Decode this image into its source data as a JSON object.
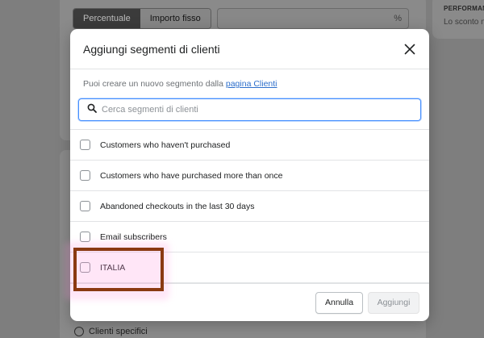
{
  "background": {
    "discount_type_options": [
      "Percentuale",
      "Importo fisso"
    ],
    "selected_discount_type": "Percentuale",
    "value_suffix": "%",
    "performance_heading": "PERFORMAN",
    "performance_text": "Lo sconto n",
    "radio_label": "Clienti specifici"
  },
  "modal": {
    "title": "Aggiungi segmenti di clienti",
    "info_text": "Puoi creare un nuovo segmento dalla ",
    "info_link": "pagina Clienti",
    "search_placeholder": "Cerca segmenti di clienti",
    "segments": [
      "Customers who haven't purchased",
      "Customers who have purchased more than once",
      "Abandoned checkouts in the last 30 days",
      "Email subscribers",
      "ITALIA"
    ],
    "cancel_label": "Annulla",
    "add_label": "Aggiungi"
  },
  "colors": {
    "link": "#2c6ecb",
    "focus_border": "#458fff",
    "highlight_border": "#8a3a12",
    "overlay": "#7e7e7e"
  }
}
